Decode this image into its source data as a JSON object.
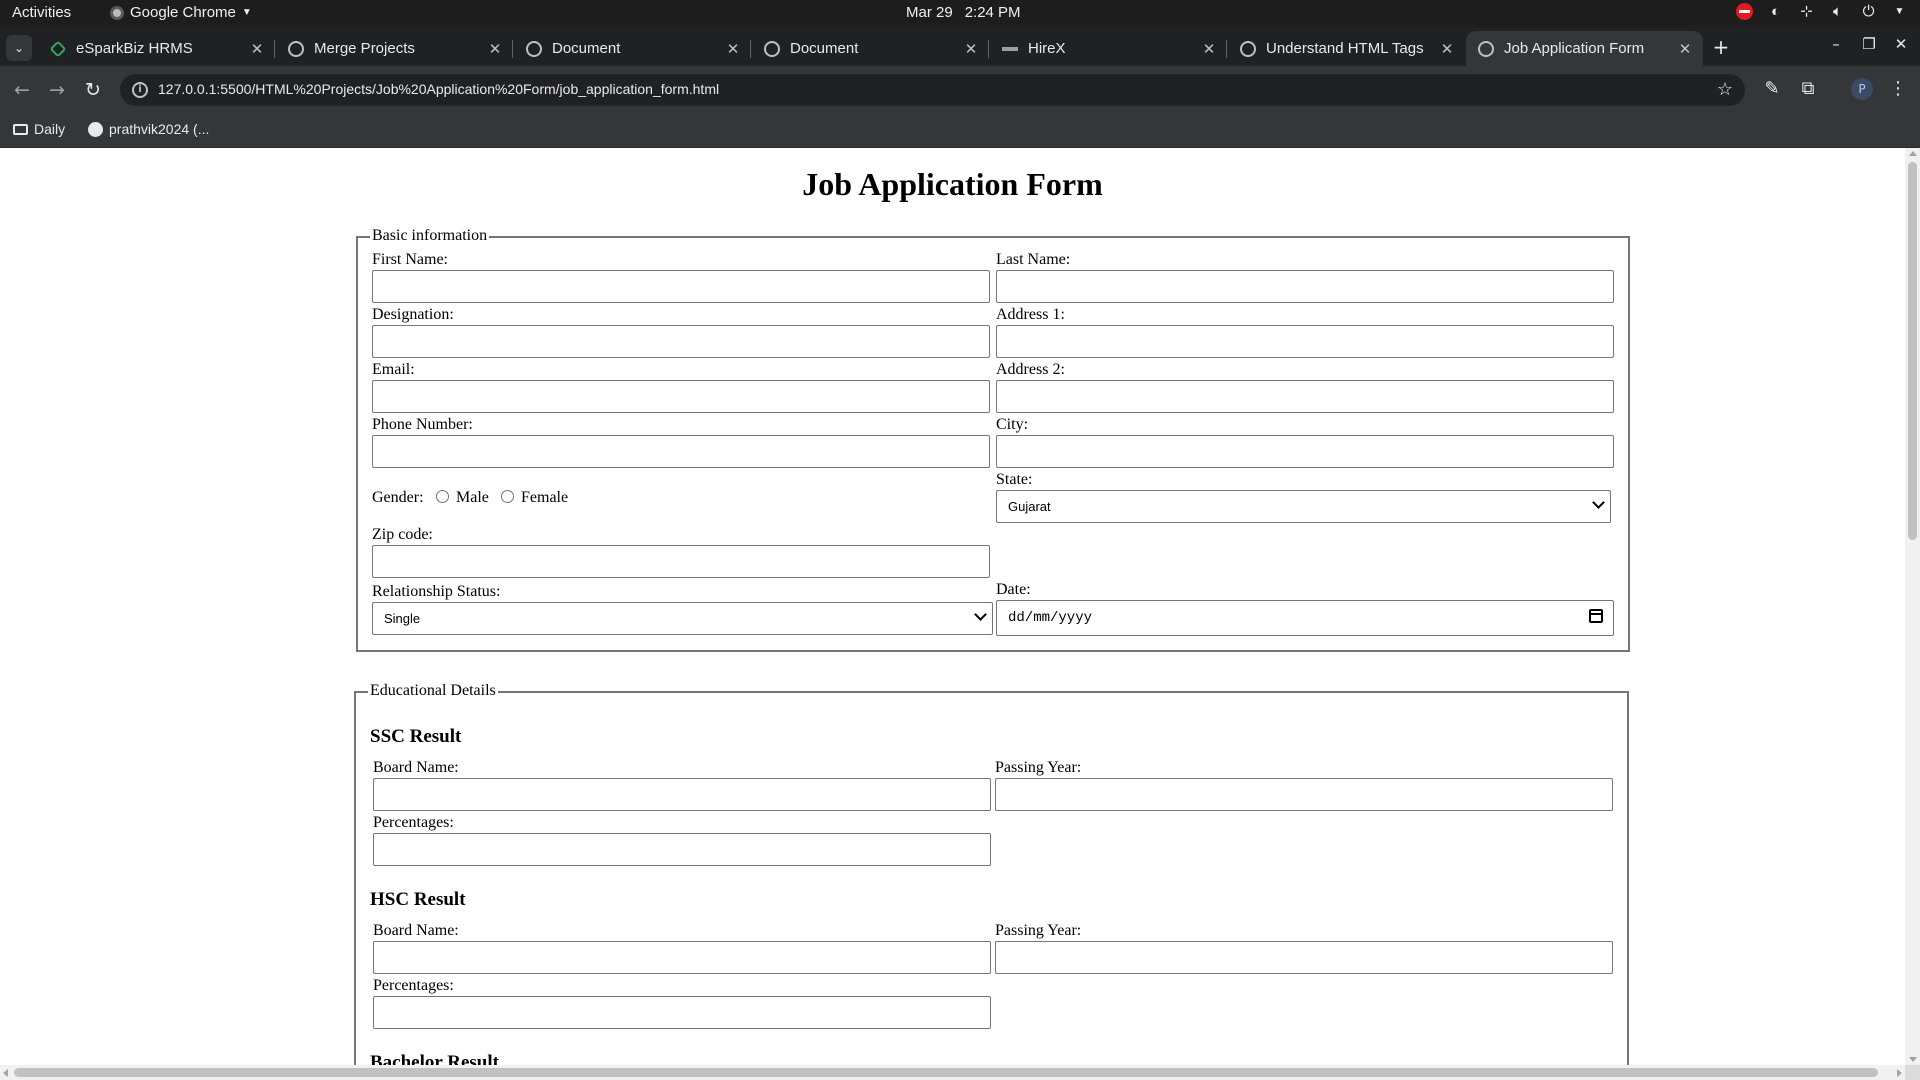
{
  "topbar": {
    "activities": "Activities",
    "app_name": "Google Chrome",
    "date": "Mar 29",
    "time": "2:24 PM"
  },
  "tabs": [
    {
      "title": "eSparkBiz HRMS",
      "icon": "esparkbiz-icon"
    },
    {
      "title": "Merge Projects",
      "icon": "globe-icon"
    },
    {
      "title": "Document",
      "icon": "globe-icon"
    },
    {
      "title": "Document",
      "icon": "globe-icon"
    },
    {
      "title": "HireX",
      "icon": "hirex-icon"
    },
    {
      "title": "Understand HTML Tags",
      "icon": "globe-icon"
    },
    {
      "title": "Job Application Form",
      "icon": "globe-icon",
      "active": true
    }
  ],
  "address_bar": {
    "url": "127.0.0.1:5500/HTML%20Projects/Job%20Application%20Form/job_application_form.html"
  },
  "bookmarks": [
    {
      "label": "Daily",
      "icon": "folder-icon"
    },
    {
      "label": "prathvik2024 (...",
      "icon": "github-icon"
    }
  ],
  "profile": {
    "initial": "P"
  },
  "page": {
    "title": "Job Application Form",
    "basic": {
      "legend": "Basic information",
      "first_name": "First Name:",
      "last_name": "Last Name:",
      "designation": "Designation:",
      "address1": "Address 1:",
      "email": "Email:",
      "address2": "Address 2:",
      "phone": "Phone Number:",
      "city": "City:",
      "gender": "Gender:",
      "male": "Male",
      "female": "Female",
      "state": "State:",
      "state_value": "Gujarat",
      "zip": "Zip code:",
      "relationship": "Relationship Status:",
      "relationship_value": "Single",
      "date": "Date:",
      "date_placeholder": "dd/mm/yyyy"
    },
    "education": {
      "legend": "Educational Details",
      "ssc": {
        "heading": "SSC Result",
        "board": "Board Name:",
        "year": "Passing Year:",
        "percent": "Percentages:"
      },
      "hsc": {
        "heading": "HSC Result",
        "board": "Board Name:",
        "year": "Passing Year:",
        "percent": "Percentages:"
      },
      "bachelor": {
        "heading": "Bachelor Result"
      }
    }
  }
}
